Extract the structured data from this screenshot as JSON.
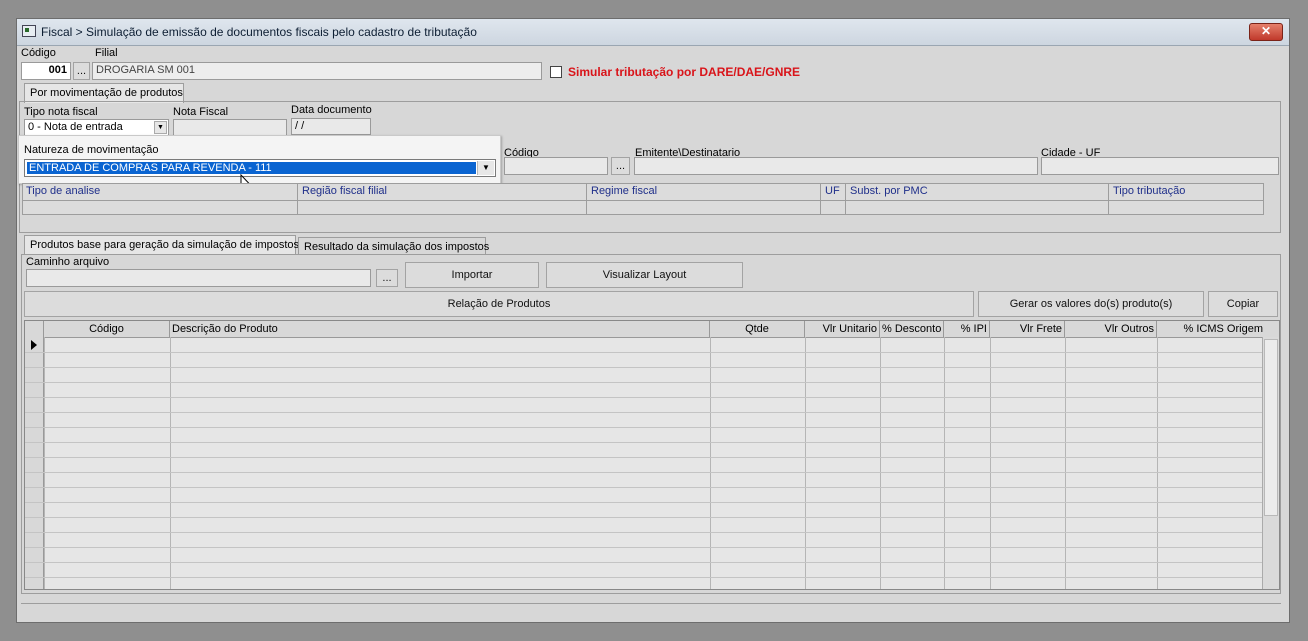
{
  "window": {
    "title": "Fiscal > Simulação de emissão de documentos fiscais pelo cadastro de tributação",
    "close_label": "✕"
  },
  "header": {
    "codigo_label": "Código",
    "codigo_value": "001",
    "filial_label": "Filial",
    "filial_value": "DROGARIA SM 001",
    "browse_label": "...",
    "simular_label": "Simular tributação por DARE/DAE/GNRE"
  },
  "main_tab": {
    "label": "Por movimentação de produtos"
  },
  "nota": {
    "tipo_label": "Tipo nota fiscal",
    "tipo_value": "0 - Nota de entrada",
    "nota_fiscal_label": "Nota Fiscal",
    "nota_fiscal_value": "",
    "data_label": "Data documento",
    "data_value": " /  /"
  },
  "natureza": {
    "label": "Natureza de movimentação",
    "value": "ENTRADA DE COMPRAS PARA REVENDA - 111"
  },
  "emitente": {
    "codigo_label": "Código",
    "browse_label": "...",
    "emitente_label": "Emitente\\Destinatario",
    "cidade_label": "Cidade - UF"
  },
  "analysis_headers": [
    "Tipo de analise",
    "Região fiscal filial",
    "Regime fiscal",
    "UF",
    "Subst. por PMC",
    "Tipo tributação"
  ],
  "sub_tabs": [
    "Produtos base para geração da simulação de impostos",
    "Resultado da simulação dos impostos"
  ],
  "arquivo": {
    "label": "Caminho arquivo",
    "browse_label": "...",
    "importar_label": "Importar",
    "layout_label": "Visualizar Layout"
  },
  "actions": {
    "relacao_label": "Relação de Produtos",
    "gerar_label": "Gerar os valores do(s) produto(s)",
    "copiar_label": "Copiar"
  },
  "grid": {
    "columns": [
      "Código",
      "Descrição do Produto",
      "Qtde",
      "Vlr Unitario",
      "% Desconto",
      "% IPI",
      "Vlr Frete",
      "Vlr Outros",
      "% ICMS Origem"
    ],
    "row_count": 17
  },
  "colors": {
    "accent": "#0a64d1",
    "warning": "#d9141a",
    "header_text": "#1f2f8a"
  }
}
